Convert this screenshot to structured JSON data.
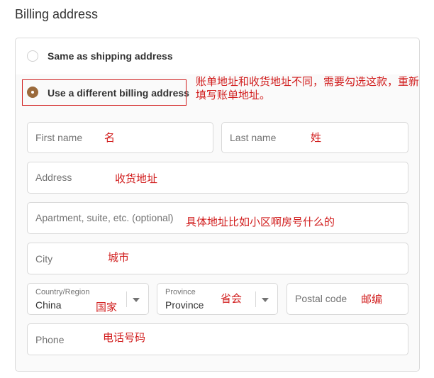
{
  "section_title": "Billing address",
  "options": {
    "same": {
      "label": "Same as shipping address",
      "selected": false
    },
    "different": {
      "label": "Use a different billing address",
      "selected": true
    }
  },
  "fields": {
    "first_name": {
      "placeholder": "First name"
    },
    "last_name": {
      "placeholder": "Last name"
    },
    "address": {
      "placeholder": "Address"
    },
    "apartment": {
      "placeholder": "Apartment, suite, etc. (optional)"
    },
    "city": {
      "placeholder": "City"
    },
    "country": {
      "label": "Country/Region",
      "value": "China"
    },
    "province": {
      "label": "Province",
      "value": "Province"
    },
    "postal_code": {
      "placeholder": "Postal code"
    },
    "phone": {
      "placeholder": "Phone"
    }
  },
  "annotations": {
    "billing_note_line1": "账单地址和收货地址不同，需要勾选这款，重新",
    "billing_note_line2": "填写账单地址。",
    "first_name": "名",
    "last_name": "姓",
    "address": "收货地址",
    "apartment": "具体地址比如小区啊房号什么的",
    "city": "城市",
    "country": "国家",
    "province": "省会",
    "postal_code": "邮编",
    "phone": "电话号码"
  },
  "colors": {
    "accent": "#9b6a3c",
    "annotation_red": "#d11d1d",
    "border": "#d9d9d9"
  }
}
